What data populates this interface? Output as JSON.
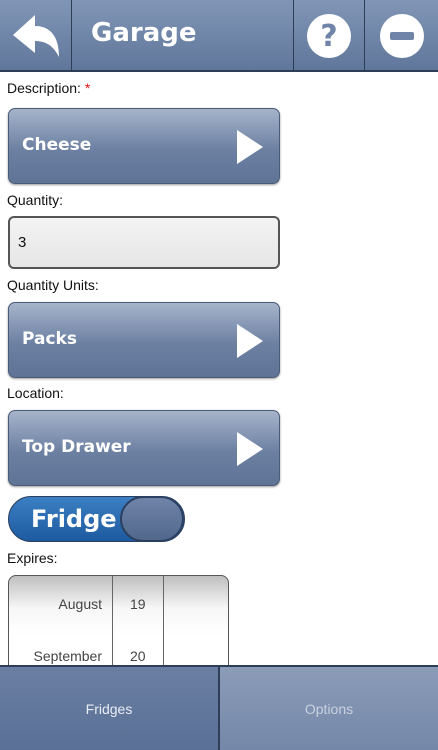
{
  "header": {
    "title": "Garage",
    "back_icon": "back-arrow-icon",
    "help_icon": "help-icon",
    "remove_icon": "minus-icon"
  },
  "form": {
    "description": {
      "label": "Description:",
      "required_marker": "*",
      "value": "Cheese"
    },
    "quantity": {
      "label": "Quantity:",
      "value": "3"
    },
    "quantity_units": {
      "label": "Quantity Units:",
      "value": "Packs"
    },
    "location": {
      "label": "Location:",
      "value": "Top Drawer"
    },
    "storage_toggle": {
      "label": "Fridge",
      "on": true
    },
    "expires": {
      "label": "Expires:",
      "months": [
        "August",
        "September"
      ],
      "days": [
        "19",
        "20"
      ]
    }
  },
  "tabs": [
    {
      "label": "Fridges",
      "active": true
    },
    {
      "label": "Options",
      "active": false
    }
  ],
  "colors": {
    "header": "#6f84a8",
    "toggle_on": "#2a6bb0",
    "required": "#dd1111"
  }
}
